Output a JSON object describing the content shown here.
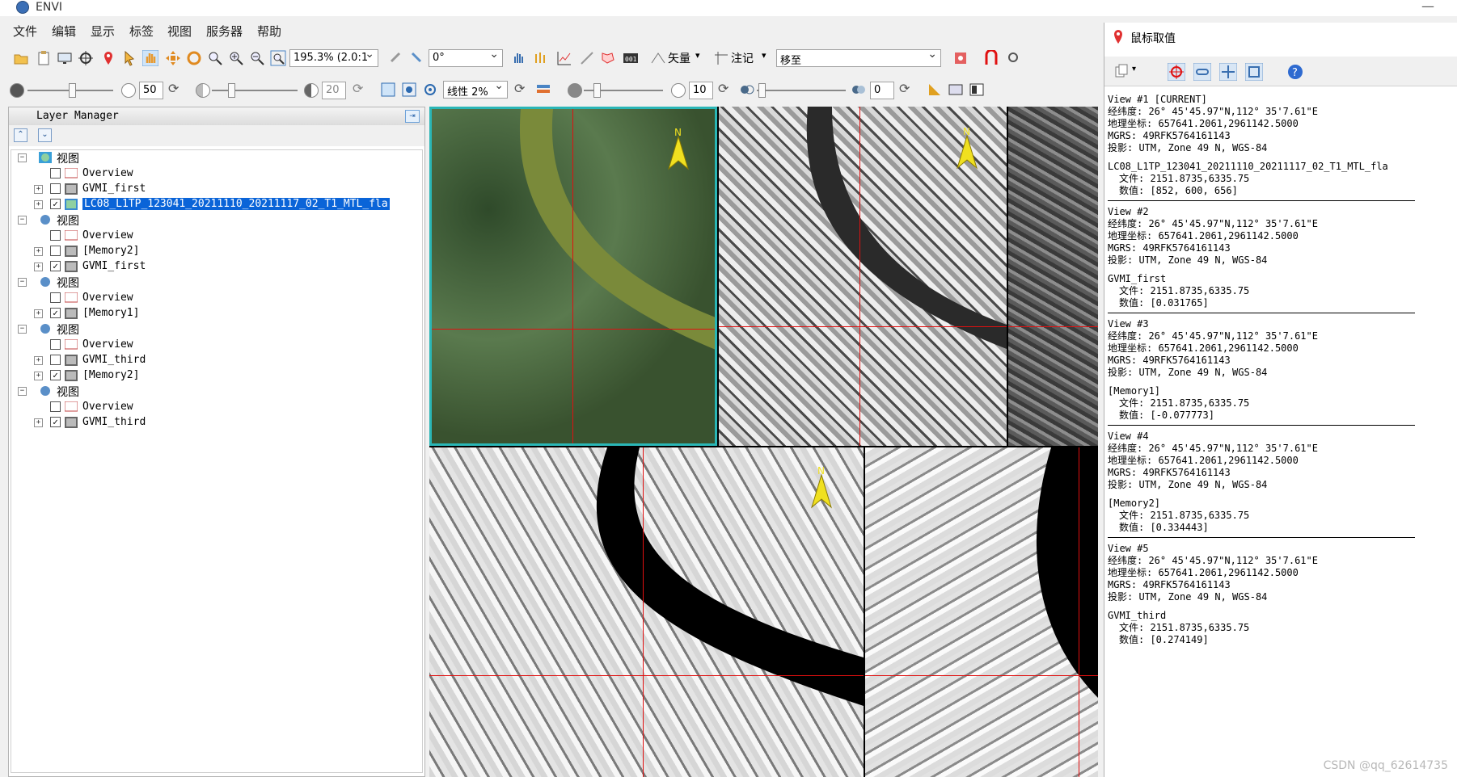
{
  "app": {
    "title": "ENVI"
  },
  "menu": [
    "文件",
    "编辑",
    "显示",
    "标签",
    "视图",
    "服务器",
    "帮助"
  ],
  "toolbar": {
    "zoom_value": "195.3% (2.0:1",
    "rotation_value": "0°",
    "vector_label": "矢量",
    "annotation_label": "注记",
    "mode_value": "移至",
    "brightness_value": "50",
    "contrast_value": "20",
    "stretch_value": "线性 2%",
    "sharpen_value": "10",
    "transparency_value": "0"
  },
  "layer_manager": {
    "title": "Layer Manager",
    "views": [
      {
        "label": "视图",
        "layers": [
          {
            "name": "Overview",
            "checked": false
          },
          {
            "name": "GVMI_first",
            "checked": false
          },
          {
            "name": "LC08_L1TP_123041_20211110_20211117_02_T1_MTL_fla",
            "checked": true,
            "selected": true
          }
        ]
      },
      {
        "label": "视图",
        "layers": [
          {
            "name": "Overview",
            "checked": false
          },
          {
            "name": "[Memory2]",
            "checked": false
          },
          {
            "name": "GVMI_first",
            "checked": true
          }
        ]
      },
      {
        "label": "视图",
        "layers": [
          {
            "name": "Overview",
            "checked": false
          },
          {
            "name": "[Memory1]",
            "checked": true
          }
        ]
      },
      {
        "label": "视图",
        "layers": [
          {
            "name": "Overview",
            "checked": false
          },
          {
            "name": "GVMI_third",
            "checked": false
          },
          {
            "name": "[Memory2]",
            "checked": true
          }
        ]
      },
      {
        "label": "视图",
        "layers": [
          {
            "name": "Overview",
            "checked": false
          },
          {
            "name": "GVMI_third",
            "checked": true
          }
        ]
      }
    ]
  },
  "cursor_value": {
    "title": "鼠标取值",
    "views": [
      {
        "header": "View #1 [CURRENT]",
        "latlon": "经纬度:  26° 45'45.97\"N,112° 35'7.61\"E",
        "map": "地理坐标:  657641.2061,2961142.5000",
        "mgrs": "MGRS: 49RFK5764161143",
        "proj": "投影:  UTM, Zone 49 N, WGS-84",
        "layer": "LC08_L1TP_123041_20211110_20211117_02_T1_MTL_fla",
        "file": "文件:  2151.8735,6335.75",
        "data": "数值:  [852, 600, 656]"
      },
      {
        "header": "View #2",
        "latlon": "经纬度:  26° 45'45.97\"N,112° 35'7.61\"E",
        "map": "地理坐标:  657641.2061,2961142.5000",
        "mgrs": "MGRS: 49RFK5764161143",
        "proj": "投影:  UTM, Zone 49 N, WGS-84",
        "layer": "GVMI_first",
        "file": "文件:  2151.8735,6335.75",
        "data": "数值:  [0.031765]"
      },
      {
        "header": "View #3",
        "latlon": "经纬度:  26° 45'45.97\"N,112° 35'7.61\"E",
        "map": "地理坐标:  657641.2061,2961142.5000",
        "mgrs": "MGRS: 49RFK5764161143",
        "proj": "投影:  UTM, Zone 49 N, WGS-84",
        "layer": "[Memory1]",
        "file": "文件:  2151.8735,6335.75",
        "data": "数值:  [-0.077773]"
      },
      {
        "header": "View #4",
        "latlon": "经纬度:  26° 45'45.97\"N,112° 35'7.61\"E",
        "map": "地理坐标:  657641.2061,2961142.5000",
        "mgrs": "MGRS: 49RFK5764161143",
        "proj": "投影:  UTM, Zone 49 N, WGS-84",
        "layer": "[Memory2]",
        "file": "文件:  2151.8735,6335.75",
        "data": "数值:  [0.334443]"
      },
      {
        "header": "View #5",
        "latlon": "经纬度:  26° 45'45.97\"N,112° 35'7.61\"E",
        "map": "地理坐标:  657641.2061,2961142.5000",
        "mgrs": "MGRS: 49RFK5764161143",
        "proj": "投影:  UTM, Zone 49 N, WGS-84",
        "layer": "GVMI_third",
        "file": "文件:  2151.8735,6335.75",
        "data": "数值:  [0.274149]"
      }
    ]
  },
  "watermark": "CSDN @qq_62614735",
  "north_label": "N"
}
